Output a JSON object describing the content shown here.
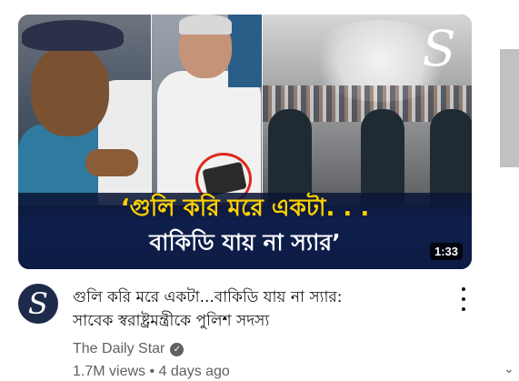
{
  "video": {
    "thumbnail": {
      "headline_line1": "‘গুলি করি মরে একটা. . .",
      "headline_line2": "বাকিডি যায় না স্যার’",
      "duration": "1:33",
      "logo_letter": "S"
    },
    "title_line1": "গুলি করি মরে একটা...বাকিডি যায় না স্যার:",
    "title_line2": "সাবেক স্বরাষ্ট্রমন্ত্রীকে পুলিশ সদস্য",
    "channel": {
      "name": "The Daily Star",
      "verified_icon": "check-circle-icon",
      "avatar_letter": "S"
    },
    "views": "1.7M views",
    "separator": "•",
    "age": "4 days ago"
  },
  "colors": {
    "headline_yellow": "#ffd200",
    "banner_blue": "#0f1f4c",
    "highlight_red": "#e0261d",
    "meta_gray": "#606060"
  }
}
